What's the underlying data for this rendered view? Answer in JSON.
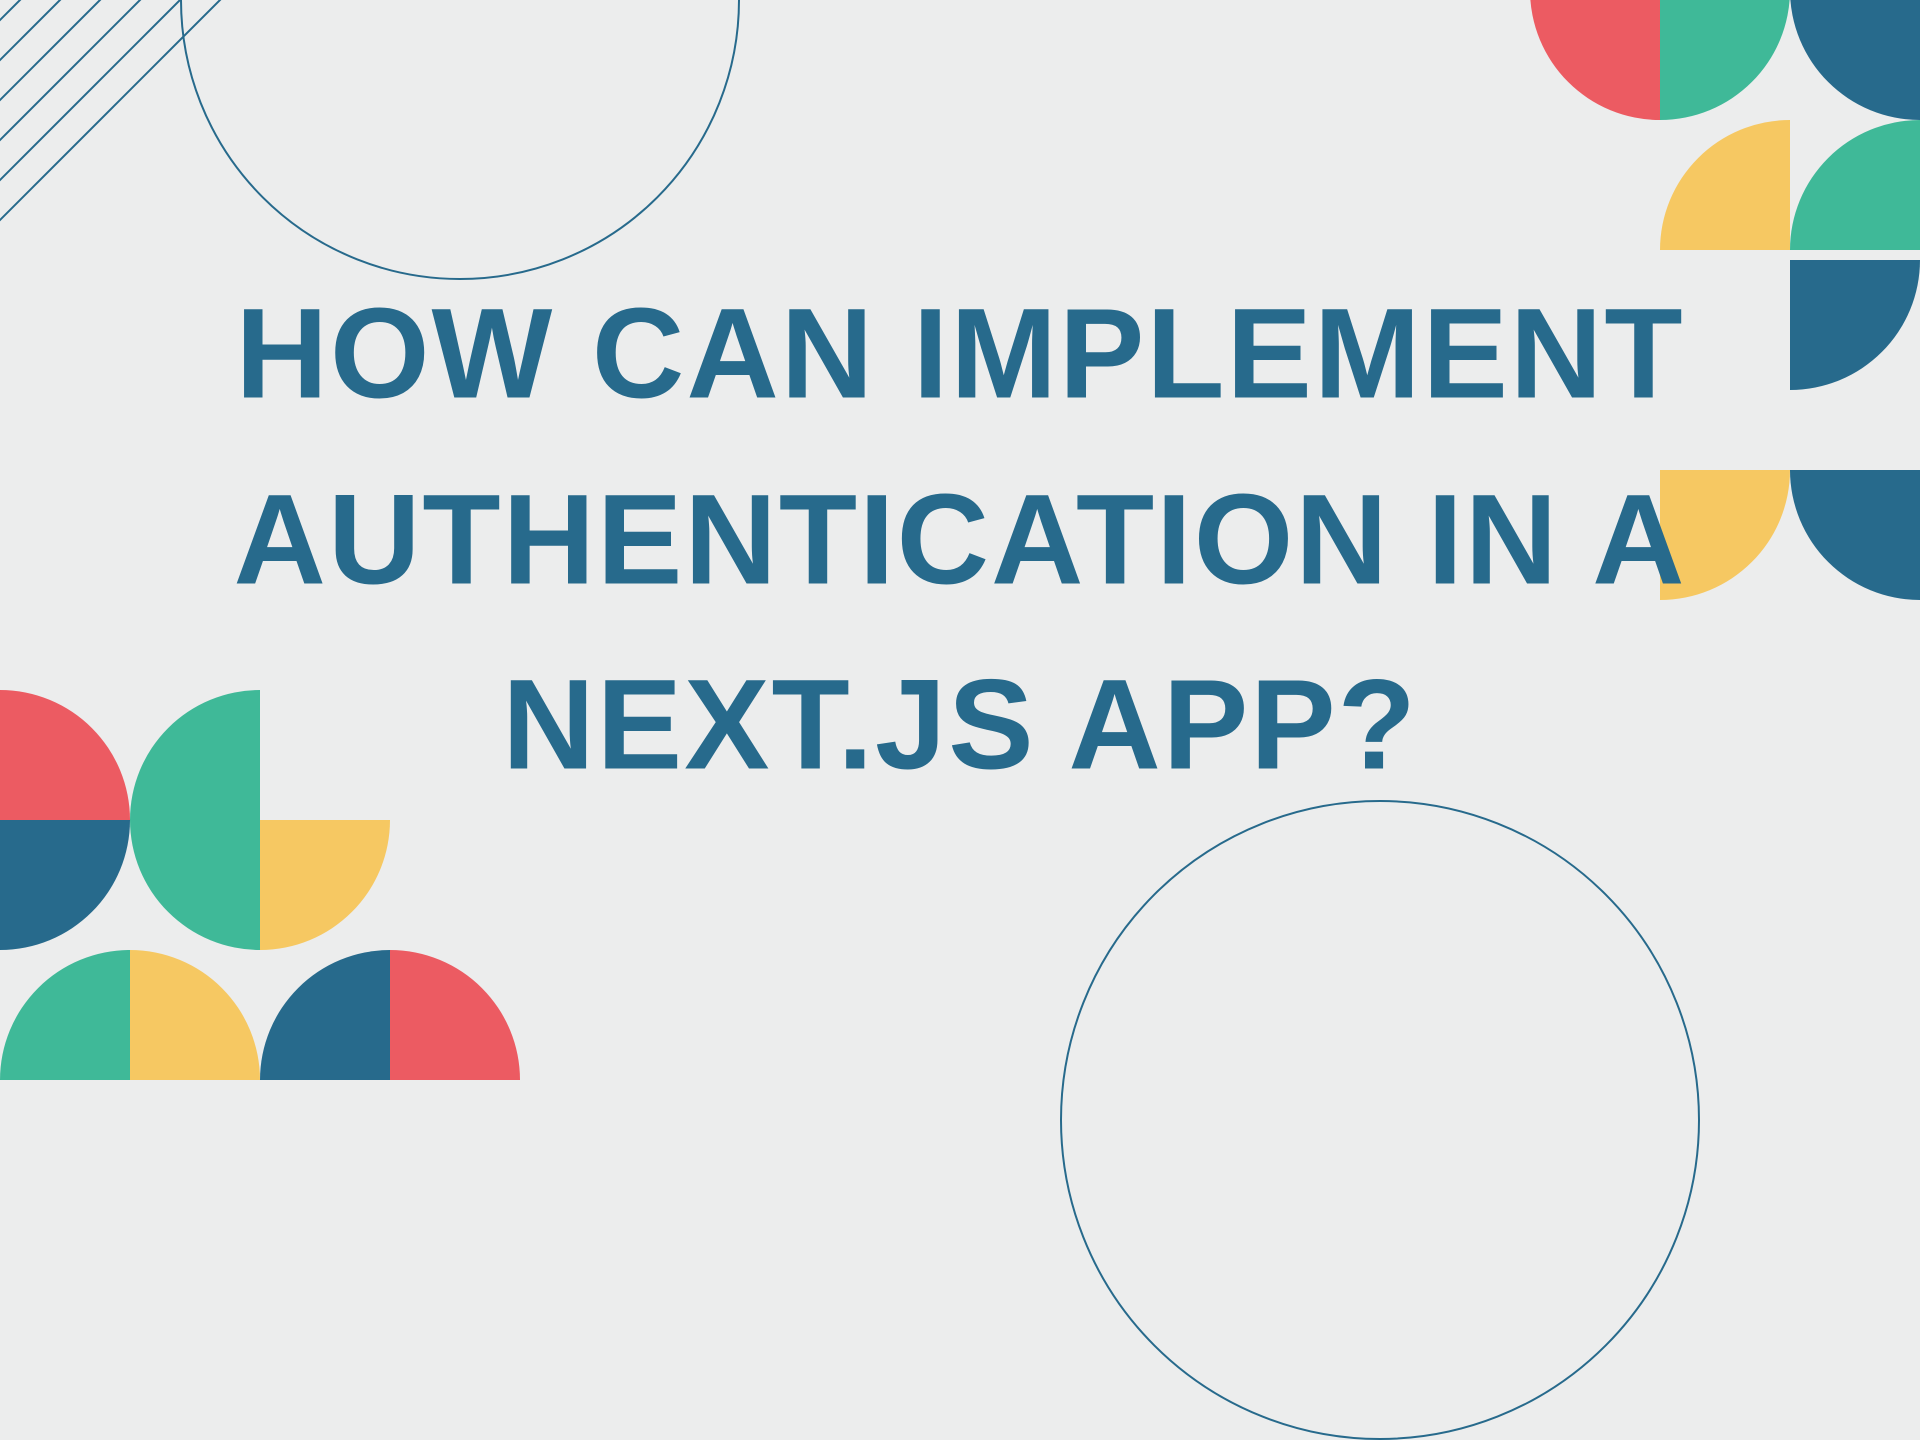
{
  "title": "HOW CAN IMPLEMENT AUTHENTICATION IN A NEXT.JS APP?",
  "colors": {
    "text": "#276a8c",
    "background": "#eceded",
    "red": "#ec5b62",
    "teal": "#3fb998",
    "blue": "#276a8c",
    "yellow": "#f6c862"
  }
}
